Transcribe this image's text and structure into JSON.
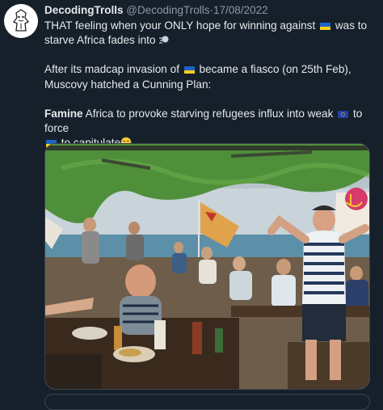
{
  "tweet": {
    "author": "DecodingTrolls",
    "handle": "@DecodingTrolls",
    "separator": "·",
    "date": "17/08/2022",
    "line1_a": "THAT feeling when your ONLY hope for winning against",
    "line1_b": "was to starve Africa fades into",
    "line2_a": "After its madcap invasion of",
    "line2_b": "became a fiasco (on 25th Feb), Muscovy hatched a Cunning Plan:",
    "line3_bold": "Famine",
    "line3_a": "Africa to provoke starving refugees influx into weak",
    "line3_b": "to force",
    "line3_c": "to capitulate",
    "line3_end": "."
  },
  "media": {
    "photo_type": "beach-cafe-singer"
  },
  "colors": {
    "background": "#15202b",
    "text": "#e7e9ea",
    "muted": "#8b98a5",
    "border": "#38444d",
    "ukraine_blue": "#1f63c6",
    "ukraine_yellow": "#f4cf1f",
    "eu_blue": "#233fa8"
  }
}
